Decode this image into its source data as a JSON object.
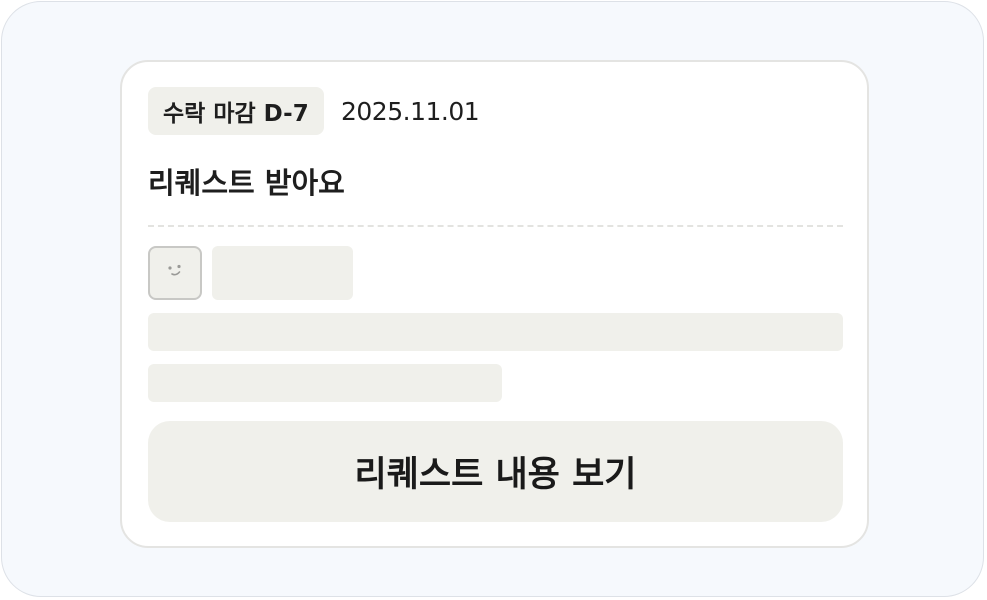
{
  "card": {
    "deadline_badge": "수락 마감 D-7",
    "date": "2025.11.01",
    "title": "리퀘스트 받아요",
    "view_button_label": "리퀘스트 내용 보기"
  },
  "avatar": {
    "icon": "smiley-face-icon"
  },
  "colors": {
    "background": "#f6f9fd",
    "card": "#ffffff",
    "skeleton": "#f0f0eb",
    "text": "#1e1e1e"
  }
}
